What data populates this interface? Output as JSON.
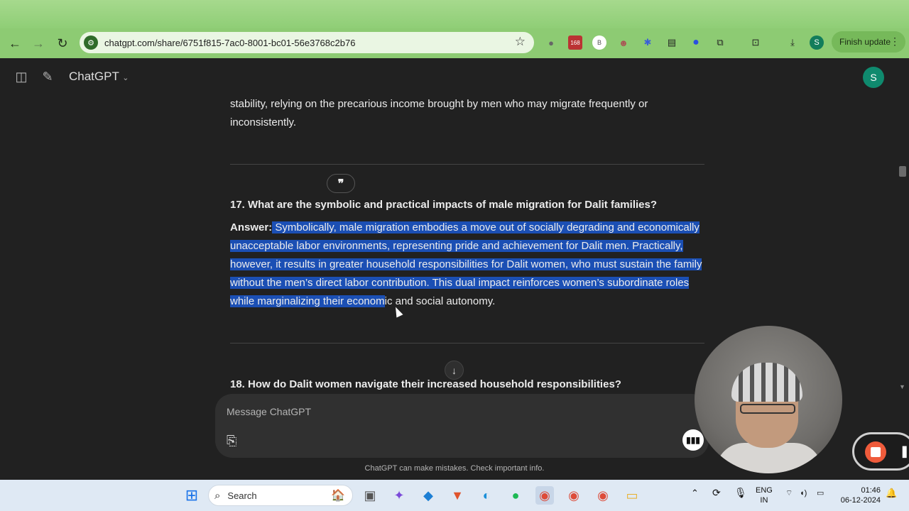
{
  "browser": {
    "url": "chatgpt.com/share/6751f815-7ac0-8001-bc01-56e3768c2b76",
    "finish_update_label": "Finish update",
    "profile_initial": "S",
    "ext_badge": "168",
    "ext_b": "B"
  },
  "app": {
    "brand": "ChatGPT",
    "avatar_initial": "S"
  },
  "content": {
    "prev_paragraph_line1": "stability, relying on the precarious income brought by men who may migrate frequently or",
    "prev_paragraph_line2": "inconsistently.",
    "quote_icon_glyph": "❞",
    "q17": "17. What are the symbolic and practical impacts of male migration for Dalit families?",
    "answer_label": "Answer:",
    "answer_line1": " Symbolically, male migration embodies a move out of socially degrading and economically",
    "answer_line2": "unacceptable labor environments, representing pride and achievement for Dalit men. Practically,",
    "answer_line3": "however, it results in greater household responsibilities for Dalit women, who must sustain the family",
    "answer_line4": "without the men’s direct labor contribution. This dual impact reinforces women’s subordinate roles",
    "answer_line5_selected": "while marginalizing their econom",
    "answer_line5_rest": "ic and social autonomy.",
    "q18": "18. How do Dalit women navigate their increased household responsibilities?"
  },
  "composer": {
    "placeholder": "Message ChatGPT"
  },
  "disclaimer": "ChatGPT can make mistakes. Check important info.",
  "taskbar": {
    "search_label": "Search",
    "lang_line1": "ENG",
    "lang_line2": "IN",
    "time": "01:46",
    "date": "06-12-2024"
  },
  "colors": {
    "selection": "#1b4fb4",
    "browser_frame": "#8dcb73",
    "app_bg": "#212121"
  }
}
